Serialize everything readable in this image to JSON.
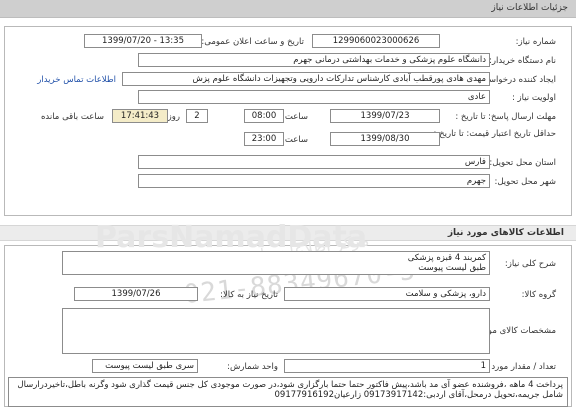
{
  "panel_title": "جزئیات اطلاعات نیاز",
  "need_info": {
    "need_number_label": "شماره نیاز:",
    "need_number": "1299060023000626",
    "announce_label": "تاریخ و ساعت اعلان عمومی:",
    "announce_value": "1399/07/20 - 13:35",
    "buyer_org_label": "نام دستگاه خریدار:",
    "buyer_org": "دانشگاه علوم پزشکی و خدمات بهداشتی درمانی جهرم",
    "requester_label": "ایجاد کننده درخواست:",
    "requester": "مهدی هادی پورقطب آبادی کارشناس تدارکات دارویی وتجهیزات دانشگاه علوم پزش",
    "contact_link": "اطلاعات تماس خریدار",
    "priority_label": "اولویت نیاز :",
    "priority": "عادی",
    "reply_deadline_label": "مهلت ارسال پاسخ: تا تاریخ :",
    "reply_date": "1399/07/23",
    "time_label": "ساعت",
    "reply_time": "08:00",
    "days_value": "2",
    "days_label": "روز و",
    "remaining_time": "17:41:43",
    "remaining_label": "ساعت باقی مانده",
    "price_validity_label": "حداقل تاریخ اعتبار قیمت: تا تاریخ :",
    "price_date": "1399/08/30",
    "price_time": "23:00",
    "province_label": "استان محل تحویل:",
    "province": "فارس",
    "city_label": "شهر محل تحویل:",
    "city": "جهرم"
  },
  "goods": {
    "section_title": "اطلاعات کالاهای مورد نیاز",
    "summary_label": "شرح کلی نیاز:",
    "summary_line1": "کمربند 4 قبزه پزشکی",
    "summary_line2": "طبق لیست پیوست",
    "group_label": "گروه کالا:",
    "group_value": "دارو، پزشکی و سلامت",
    "need_date_label": "تاریخ نیاز به کالا:",
    "need_date": "1399/07/26",
    "specs_label": "مشخصات کالای مورد نیاز:",
    "qty_label": "تعداد / مقدار مورد نیاز:",
    "qty_value": "1",
    "unit_label": "واحد شمارش:",
    "unit_value": "سری طبق لیست پیوست",
    "notes": "پرداخت 4 ماهه ،فروشنده عضو آی مد باشد،پیش فاکتور حتما حتما بارگزاری شود،در صورت موجودی کل جنس قیمت گذاری شود وگرنه باطل،تاخیردرارسال شامل جریمه،تحویل درمحل،آقای اردبی:09173917142 زارعیان09177916192"
  },
  "watermark": {
    "brand": "ParsNamadData",
    "sub": "مرکز اطلاعات پارس نماد داده",
    "phone": "021-88349670-5"
  }
}
